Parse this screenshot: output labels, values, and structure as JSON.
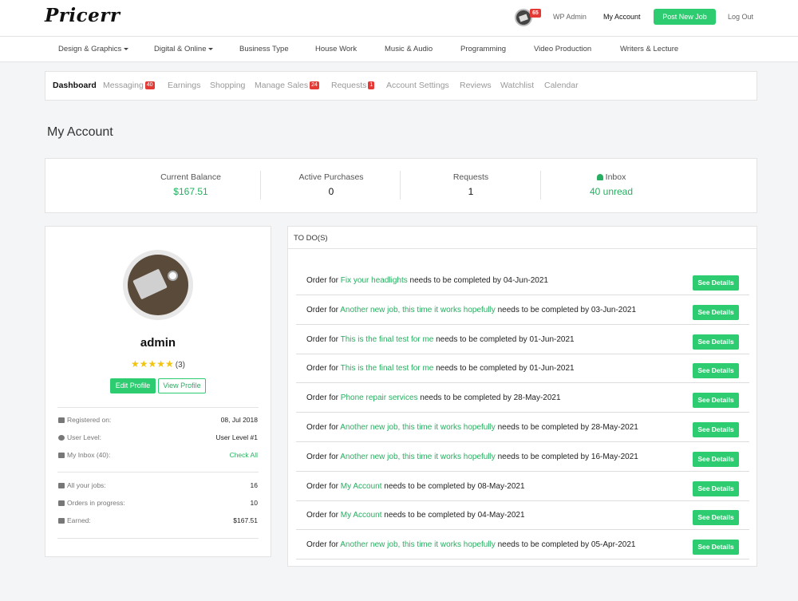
{
  "header": {
    "logo": "Pricerr",
    "notif_count": "65",
    "wp_admin": "WP Admin",
    "my_account": "My Account",
    "post_job": "Post New Job",
    "logout": "Log Out"
  },
  "categories": [
    {
      "label": "Design & Graphics",
      "dropdown": true
    },
    {
      "label": "Digital & Online",
      "dropdown": true
    },
    {
      "label": "Business Type",
      "dropdown": false
    },
    {
      "label": "House Work",
      "dropdown": false
    },
    {
      "label": "Music & Audio",
      "dropdown": false
    },
    {
      "label": "Programming",
      "dropdown": false
    },
    {
      "label": "Video Production",
      "dropdown": false
    },
    {
      "label": "Writers & Lecture",
      "dropdown": false
    }
  ],
  "tabs": [
    {
      "label": "Dashboard",
      "badge": ""
    },
    {
      "label": "Messaging",
      "badge": "40"
    },
    {
      "label": "Earnings",
      "badge": ""
    },
    {
      "label": "Shopping",
      "badge": ""
    },
    {
      "label": "Manage Sales",
      "badge": "24"
    },
    {
      "label": "Requests",
      "badge": "1"
    },
    {
      "label": "Account Settings",
      "badge": ""
    },
    {
      "label": "Reviews",
      "badge": ""
    },
    {
      "label": "Watchlist",
      "badge": ""
    },
    {
      "label": "Calendar",
      "badge": ""
    }
  ],
  "page_title": "My Account",
  "stats": [
    {
      "label": "Current Balance",
      "value": "$167.51"
    },
    {
      "label": "Active Purchases",
      "value": "0"
    },
    {
      "label": "Requests",
      "value": "1"
    },
    {
      "label": "Inbox",
      "value": "40 unread"
    }
  ],
  "profile": {
    "username": "admin",
    "stars": "★★★★★",
    "rating_count": "(3)",
    "edit_label": "Edit Profile",
    "view_label": "View Profile",
    "info": [
      {
        "key": "Registered on:",
        "value": "08, Jul 2018"
      },
      {
        "key": "User Level:",
        "value": "User Level #1"
      },
      {
        "key": "My Inbox (40):",
        "value": "Check All"
      },
      {
        "key": "All your jobs:",
        "value": "16"
      },
      {
        "key": "Orders in progress:",
        "value": "10"
      },
      {
        "key": "Earned:",
        "value": "$167.51"
      }
    ]
  },
  "todo": {
    "title": "TO DO(S)",
    "prefix": "Order for",
    "middle": "needs to be completed by",
    "button": "See Details",
    "items": [
      {
        "job": "Fix your headlights",
        "date": "04-Jun-2021"
      },
      {
        "job": "Another new job, this time it works hopefully",
        "date": "03-Jun-2021"
      },
      {
        "job": "This is the final test for me",
        "date": "01-Jun-2021"
      },
      {
        "job": "This is the final test for me",
        "date": "01-Jun-2021"
      },
      {
        "job": "Phone repair services",
        "date": "28-May-2021"
      },
      {
        "job": "Another new job, this time it works hopefully",
        "date": "28-May-2021"
      },
      {
        "job": "Another new job, this time it works hopefully",
        "date": "16-May-2021"
      },
      {
        "job": "My Account",
        "date": "08-May-2021"
      },
      {
        "job": "My Account",
        "date": "04-May-2021"
      },
      {
        "job": "Another new job, this time it works hopefully",
        "date": "05-Apr-2021"
      }
    ]
  }
}
